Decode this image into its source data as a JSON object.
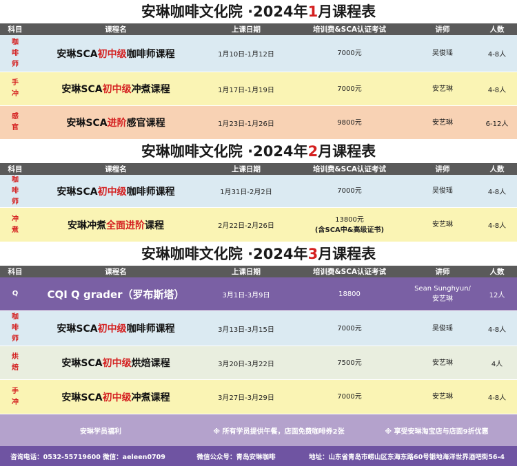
{
  "headers": [
    "科目",
    "课程名",
    "上课日期",
    "培训费&SCA认证考试",
    "讲师",
    "人数"
  ],
  "sections": [
    {
      "title_prefix": "安琳咖啡文化院 ·2024年",
      "month": "1",
      "title_suffix": "月课程表",
      "rows": [
        {
          "category": "咖\n啡\n师",
          "name_pre": "安琳SCA",
          "name_hl": "初中级",
          "name_post": "咖啡师课程",
          "dates": "1月10日-1月12日",
          "fee": "7000元",
          "fee_note": "",
          "teacher": "吴俊瑶",
          "people": "4-8人",
          "bg": "blue",
          "h": 54
        },
        {
          "category": "手\n冲",
          "name_pre": "安琳SCA",
          "name_hl": "初中级",
          "name_post": "冲煮课程",
          "dates": "1月17日-1月19日",
          "fee": "7000元",
          "fee_note": "",
          "teacher": "安艺琳",
          "people": "4-8人",
          "bg": "yellow",
          "h": 49
        },
        {
          "category": "感\n官",
          "name_pre": "安琳SCA",
          "name_hl": "进阶",
          "name_post": "感官课程",
          "dates": "1月23日-1月26日",
          "fee": "9800元",
          "fee_note": "",
          "teacher": "安艺琳",
          "people": "6-12人",
          "bg": "orange",
          "h": 49
        }
      ]
    },
    {
      "title_prefix": "安琳咖啡文化院 ·2024年",
      "month": "2",
      "title_suffix": "月课程表",
      "rows": [
        {
          "category": "咖\n啡\n师",
          "name_pre": "安琳SCA",
          "name_hl": "初中级",
          "name_post": "咖啡师课程",
          "dates": "1月31日-2月2日",
          "fee": "7000元",
          "fee_note": "",
          "teacher": "吴俊瑶",
          "people": "4-8人",
          "bg": "blue",
          "h": 48
        },
        {
          "category": "冲\n煮",
          "name_pre": "安琳冲煮",
          "name_hl": "全面进阶",
          "name_post": "课程",
          "dates": "2月22日-2月26日",
          "fee": "13800元",
          "fee_note": "(含SCA中&高级证书)",
          "teacher": "安艺琳",
          "people": "4-8人",
          "bg": "yellow",
          "h": 50
        }
      ]
    },
    {
      "title_prefix": "安琳咖啡文化院 ·2024年",
      "month": "3",
      "title_suffix": "月课程表",
      "rows": [
        {
          "category": "Q",
          "name_pre": "CQI Q grader（罗布斯塔）",
          "name_hl": "",
          "name_post": "",
          "dates": "3月1日-3月9日",
          "fee": "18800",
          "fee_note": "",
          "teacher": "Sean Sunghyun/\n安艺琳",
          "people": "12人",
          "bg": "purple",
          "h": 49
        },
        {
          "category": "咖\n啡\n师",
          "name_pre": "安琳SCA",
          "name_hl": "初中级",
          "name_post": "咖啡师课程",
          "dates": "3月13日-3月15日",
          "fee": "7000元",
          "fee_note": "",
          "teacher": "吴俊瑶",
          "people": "4-8人",
          "bg": "blue",
          "h": 51
        },
        {
          "category": "烘\n焙",
          "name_pre": "安琳SCA",
          "name_hl": "初中级",
          "name_post": "烘焙课程",
          "dates": "3月20日-3月22日",
          "fee": "7500元",
          "fee_note": "",
          "teacher": "安艺琳",
          "people": "4人",
          "bg": "green",
          "h": 49
        },
        {
          "category": "手\n冲",
          "name_pre": "安琳SCA",
          "name_hl": "初中级",
          "name_post": "冲煮课程",
          "dates": "3月27日-3月29日",
          "fee": "7000元",
          "fee_note": "",
          "teacher": "安艺琳",
          "people": "4-8人",
          "bg": "yellow",
          "h": 50
        }
      ]
    }
  ],
  "benefits": {
    "title": "安琳学员福利",
    "item1": "※ 所有学员提供午餐，店面免费咖啡券2张",
    "item2": "※ 享受安琳淘宝店与店面9折优惠"
  },
  "footer": {
    "phone": "咨询电话：0532-55719600  微信：aeleen0709",
    "wechat": "微信公众号：青岛安琳咖啡",
    "address": "地址：山东省青岛市崂山区东海东路60号银地海洋世界酒吧街56-4"
  },
  "colors": {
    "accent_red": "#d42020",
    "header_gray": "#5a5a5a",
    "blue": "#dbeaf2",
    "yellow": "#faf4b4",
    "orange": "#f8d2b4",
    "green": "#e9eedf",
    "purple": "#7a60a4",
    "footer_purple": "#6f54a2"
  }
}
